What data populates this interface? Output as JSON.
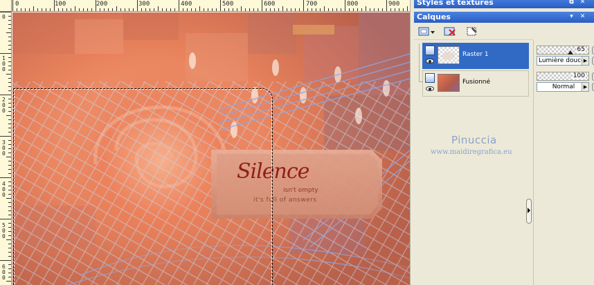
{
  "panels": {
    "styles": {
      "title": "Styles et textures"
    },
    "layers": {
      "title": "Calques"
    }
  },
  "rulers": {
    "horizontal": [
      "0",
      "100",
      "200",
      "300",
      "400",
      "500",
      "600",
      "700",
      "800",
      "900"
    ],
    "vertical": [
      "0",
      "100",
      "200",
      "300",
      "400",
      "500",
      "600"
    ]
  },
  "artwork": {
    "title": "Silence",
    "subtitle_1": "isn't empty",
    "subtitle_2": "it's full of answers"
  },
  "layers": [
    {
      "name": "Raster 1",
      "selected": true,
      "opacity": "65",
      "blend_mode": "Lumière douce"
    },
    {
      "name": "Fusionné",
      "selected": false,
      "opacity": "100",
      "blend_mode": "Normal"
    }
  ],
  "watermark": {
    "name": "Pinuccia",
    "site": "www.maidiregrafica.eu"
  },
  "icons": {
    "new_layer": "new-raster-layer-icon",
    "delete_layer": "delete-layer-icon",
    "mask": "mask-icon",
    "visibility": "eye-icon",
    "layer_type": "raster-layer-icon"
  },
  "colors": {
    "titlebar": "#2a5dc4",
    "selected_row": "#316ac5",
    "artwork_accent": "#e07a55"
  }
}
